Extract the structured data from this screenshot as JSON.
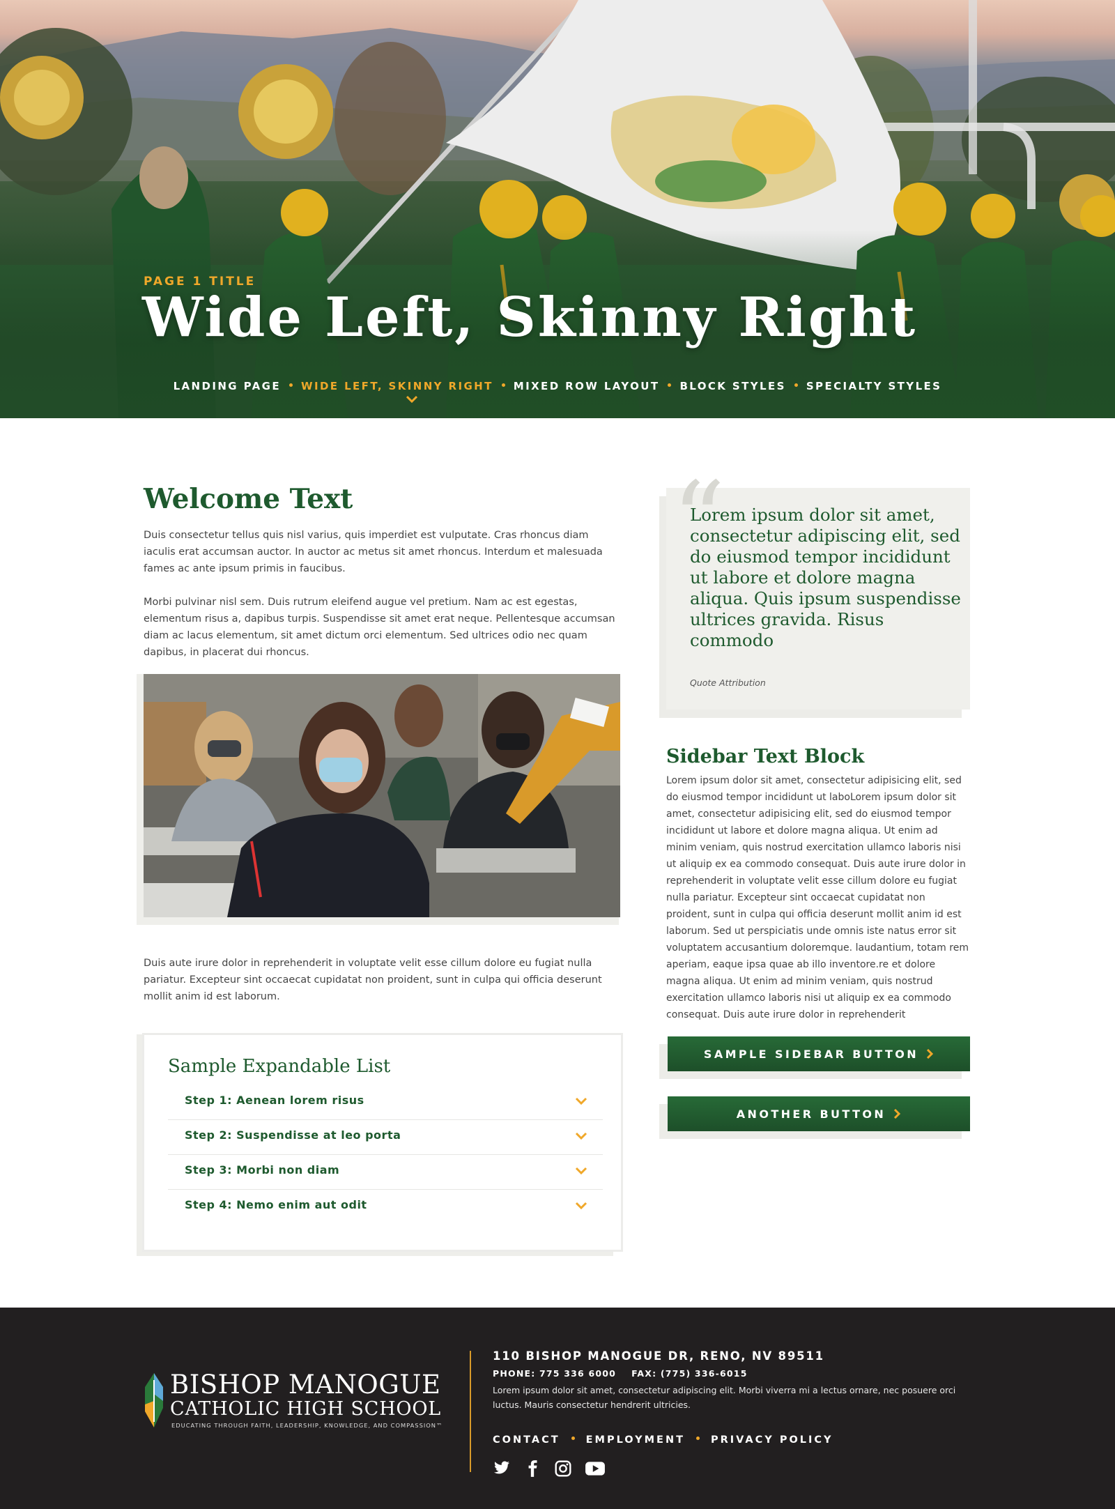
{
  "hero": {
    "kicker": "PAGE 1 TITLE",
    "title": "Wide Left, Skinny Right",
    "nav": [
      {
        "label": "LANDING PAGE",
        "active": false
      },
      {
        "label": "WIDE LEFT, SKINNY RIGHT",
        "active": true
      },
      {
        "label": "MIXED ROW LAYOUT",
        "active": false
      },
      {
        "label": "BLOCK STYLES",
        "active": false
      },
      {
        "label": "SPECIALTY STYLES",
        "active": false
      }
    ],
    "dropdown_icon": "chevron-down-icon"
  },
  "main": {
    "heading": "Welcome Text",
    "paragraph1": "Duis consectetur tellus quis nisl varius, quis imperdiet est vulputate. Cras rhoncus diam iaculis erat accumsan auctor. In auctor ac metus sit amet rhoncus. Interdum et malesuada fames ac ante ipsum primis in faucibus.",
    "paragraph2": "Morbi pulvinar nisl sem. Duis rutrum eleifend augue vel pretium. Nam ac est egestas, elementum risus a, dapibus turpis. Suspendisse sit amet erat neque. Pellentesque accumsan diam ac lacus elementum, sit amet dictum orci elementum. Sed ultrices odio nec quam dapibus, in placerat dui rhoncus.",
    "paragraph3": "Duis aute irure dolor in reprehenderit in voluptate velit esse cillum dolore eu fugiat nulla pariatur. Excepteur sint occaecat cupidatat non proident, sunt in culpa qui officia deserunt mollit anim id est laborum.",
    "expandable": {
      "title": "Sample Expandable List",
      "items": [
        "Step 1: Aenean lorem risus",
        "Step 2: Suspendisse at leo porta",
        "Step 3: Morbi non diam",
        "Step 4: Nemo enim aut odit"
      ]
    }
  },
  "sidebar": {
    "quote": "Lorem ipsum dolor sit amet, consectetur adipiscing elit, sed do eiusmod tempor incididunt ut labore et dolore magna aliqua. Quis ipsum suspendisse ultrices gravida. Risus commodo",
    "quote_attribution": "Quote Attribution",
    "text_title": "Sidebar Text Block",
    "text_body": "Lorem ipsum dolor sit amet, consectetur adipisicing elit, sed do eiusmod tempor incididunt ut laboLorem ipsum dolor sit amet, consectetur adipisicing elit, sed do eiusmod tempor incididunt ut labore et dolore magna aliqua. Ut enim ad minim veniam, quis nostrud exercitation ullamco laboris nisi ut aliquip ex ea commodo consequat. Duis aute irure dolor in reprehenderit in voluptate velit esse cillum dolore eu fugiat nulla pariatur. Excepteur sint occaecat cupidatat non proident, sunt in culpa qui officia deserunt mollit anim id est laborum. Sed ut perspiciatis unde omnis iste natus error sit voluptatem accusantium doloremque. laudantium, totam rem aperiam, eaque ipsa quae ab illo inventore.re et dolore magna aliqua. Ut enim ad minim veniam, quis nostrud exercitation ullamco laboris nisi ut aliquip ex ea commodo consequat. Duis aute irure dolor in reprehenderit",
    "button1": "SAMPLE SIDEBAR BUTTON",
    "button2": "ANOTHER BUTTON"
  },
  "footer": {
    "logo_line1": "BISHOP MANOGUE",
    "logo_line2": "CATHOLIC HIGH SCHOOL",
    "logo_tagline": "EDUCATING THROUGH FAITH, LEADERSHIP, KNOWLEDGE, AND COMPASSION™",
    "address": "110 BISHOP MANOGUE DR, RENO, NV 89511",
    "phone": "PHONE: 775 336 6000",
    "fax": "FAX: (775) 336-6015",
    "text": "Lorem ipsum dolor sit amet, consectetur adipiscing elit. Morbi viverra mi a lectus ornare, nec posuere orci luctus. Mauris consectetur hendrerit ultricies.",
    "links": [
      "CONTACT",
      "EMPLOYMENT",
      "PRIVACY POLICY"
    ],
    "social_icons": [
      "twitter-icon",
      "facebook-icon",
      "instagram-icon",
      "youtube-icon"
    ]
  },
  "colors": {
    "brand_green": "#1e5a2e",
    "accent_gold": "#f0a82a",
    "footer_bg": "#221f20"
  }
}
